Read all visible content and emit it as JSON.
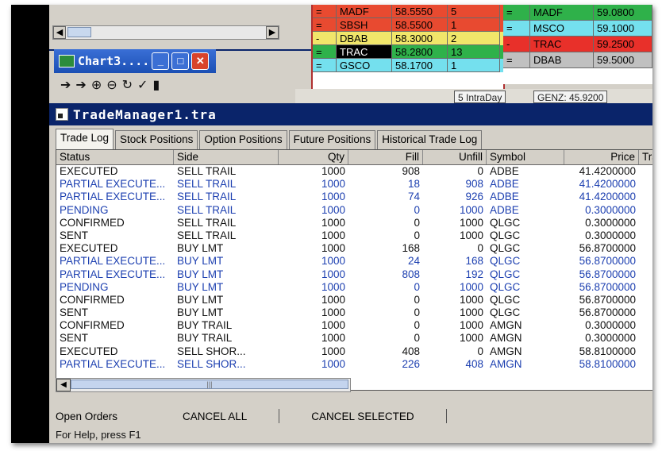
{
  "quotes_left": [
    {
      "flag": "=",
      "symbol": "MADF",
      "price": "58.5550",
      "size": "5",
      "bg": "#e84a30"
    },
    {
      "flag": "=",
      "symbol": "SBSH",
      "price": "58.5500",
      "size": "1",
      "bg": "#e84a30"
    },
    {
      "flag": "-",
      "symbol": "DBAB",
      "price": "58.3000",
      "size": "2",
      "bg": "#f1e66a"
    },
    {
      "flag": "=",
      "symbol": "TRAC",
      "price": "58.2800",
      "size": "13",
      "bg": "#2fb14a"
    },
    {
      "flag": "=",
      "symbol": "GSCO",
      "price": "58.1700",
      "size": "1",
      "bg": "#74e0ee"
    }
  ],
  "quotes_right": [
    {
      "flag": "=",
      "symbol": "MADF",
      "price": "59.0800",
      "bg": "#2fb14a"
    },
    {
      "flag": "=",
      "symbol": "MSCO",
      "price": "59.1000",
      "bg": "#74e0ee"
    },
    {
      "flag": "-",
      "symbol": "TRAC",
      "price": "59.2500",
      "bg": "#e8302a"
    },
    {
      "flag": "=",
      "symbol": "DBAB",
      "price": "59.5000",
      "bg": "#c0c0c0"
    }
  ],
  "chart_window": {
    "title": "Chart3...."
  },
  "behind_bar": {
    "interval": "5 IntraDay",
    "quote": "GENZ: 45.9200"
  },
  "trade_manager": {
    "title": "TradeManager1.tra",
    "tabs": [
      "Trade Log",
      "Stock Positions",
      "Option Positions",
      "Future Positions",
      "Historical Trade Log"
    ],
    "columns": [
      "Status",
      "Side",
      "Qty",
      "Fill",
      "Unfill",
      "Symbol",
      "Price",
      "Trad"
    ],
    "rows": [
      {
        "status": "EXECUTED",
        "side": "SELL TRAIL",
        "qty": "1000",
        "fill": "908",
        "unfill": "0",
        "symbol": "ADBE",
        "price": "41.4200000",
        "color": "black"
      },
      {
        "status": "PARTIAL EXECUTE...",
        "side": "SELL TRAIL",
        "qty": "1000",
        "fill": "18",
        "unfill": "908",
        "symbol": "ADBE",
        "price": "41.4200000",
        "color": "blue"
      },
      {
        "status": "PARTIAL EXECUTE...",
        "side": "SELL TRAIL",
        "qty": "1000",
        "fill": "74",
        "unfill": "926",
        "symbol": "ADBE",
        "price": "41.4200000",
        "color": "blue"
      },
      {
        "status": "PENDING",
        "side": "SELL TRAIL",
        "qty": "1000",
        "fill": "0",
        "unfill": "1000",
        "symbol": "ADBE",
        "price": "0.3000000",
        "color": "blue"
      },
      {
        "status": "CONFIRMED",
        "side": "SELL TRAIL",
        "qty": "1000",
        "fill": "0",
        "unfill": "1000",
        "symbol": "QLGC",
        "price": "0.3000000",
        "color": "black"
      },
      {
        "status": "SENT",
        "side": "SELL TRAIL",
        "qty": "1000",
        "fill": "0",
        "unfill": "1000",
        "symbol": "QLGC",
        "price": "0.3000000",
        "color": "black"
      },
      {
        "status": "EXECUTED",
        "side": "BUY LMT",
        "qty": "1000",
        "fill": "168",
        "unfill": "0",
        "symbol": "QLGC",
        "price": "56.8700000",
        "color": "black"
      },
      {
        "status": "PARTIAL EXECUTE...",
        "side": "BUY LMT",
        "qty": "1000",
        "fill": "24",
        "unfill": "168",
        "symbol": "QLGC",
        "price": "56.8700000",
        "color": "blue"
      },
      {
        "status": "PARTIAL EXECUTE...",
        "side": "BUY LMT",
        "qty": "1000",
        "fill": "808",
        "unfill": "192",
        "symbol": "QLGC",
        "price": "56.8700000",
        "color": "blue"
      },
      {
        "status": "PENDING",
        "side": "BUY LMT",
        "qty": "1000",
        "fill": "0",
        "unfill": "1000",
        "symbol": "QLGC",
        "price": "56.8700000",
        "color": "blue"
      },
      {
        "status": "CONFIRMED",
        "side": "BUY LMT",
        "qty": "1000",
        "fill": "0",
        "unfill": "1000",
        "symbol": "QLGC",
        "price": "56.8700000",
        "color": "black"
      },
      {
        "status": "SENT",
        "side": "BUY LMT",
        "qty": "1000",
        "fill": "0",
        "unfill": "1000",
        "symbol": "QLGC",
        "price": "56.8700000",
        "color": "black"
      },
      {
        "status": "CONFIRMED",
        "side": "BUY TRAIL",
        "qty": "1000",
        "fill": "0",
        "unfill": "1000",
        "symbol": "AMGN",
        "price": "0.3000000",
        "color": "black"
      },
      {
        "status": "SENT",
        "side": "BUY TRAIL",
        "qty": "1000",
        "fill": "0",
        "unfill": "1000",
        "symbol": "AMGN",
        "price": "0.3000000",
        "color": "black"
      },
      {
        "status": "EXECUTED",
        "side": "SELL SHOR...",
        "qty": "1000",
        "fill": "408",
        "unfill": "0",
        "symbol": "AMGN",
        "price": "58.8100000",
        "color": "black"
      },
      {
        "status": "PARTIAL EXECUTE...",
        "side": "SELL SHOR...",
        "qty": "1000",
        "fill": "226",
        "unfill": "408",
        "symbol": "AMGN",
        "price": "58.8100000",
        "color": "blue"
      }
    ],
    "open_orders_label": "Open Orders",
    "cancel_all_label": "CANCEL ALL",
    "cancel_selected_label": "CANCEL SELECTED",
    "status_text": "For Help, press F1"
  }
}
